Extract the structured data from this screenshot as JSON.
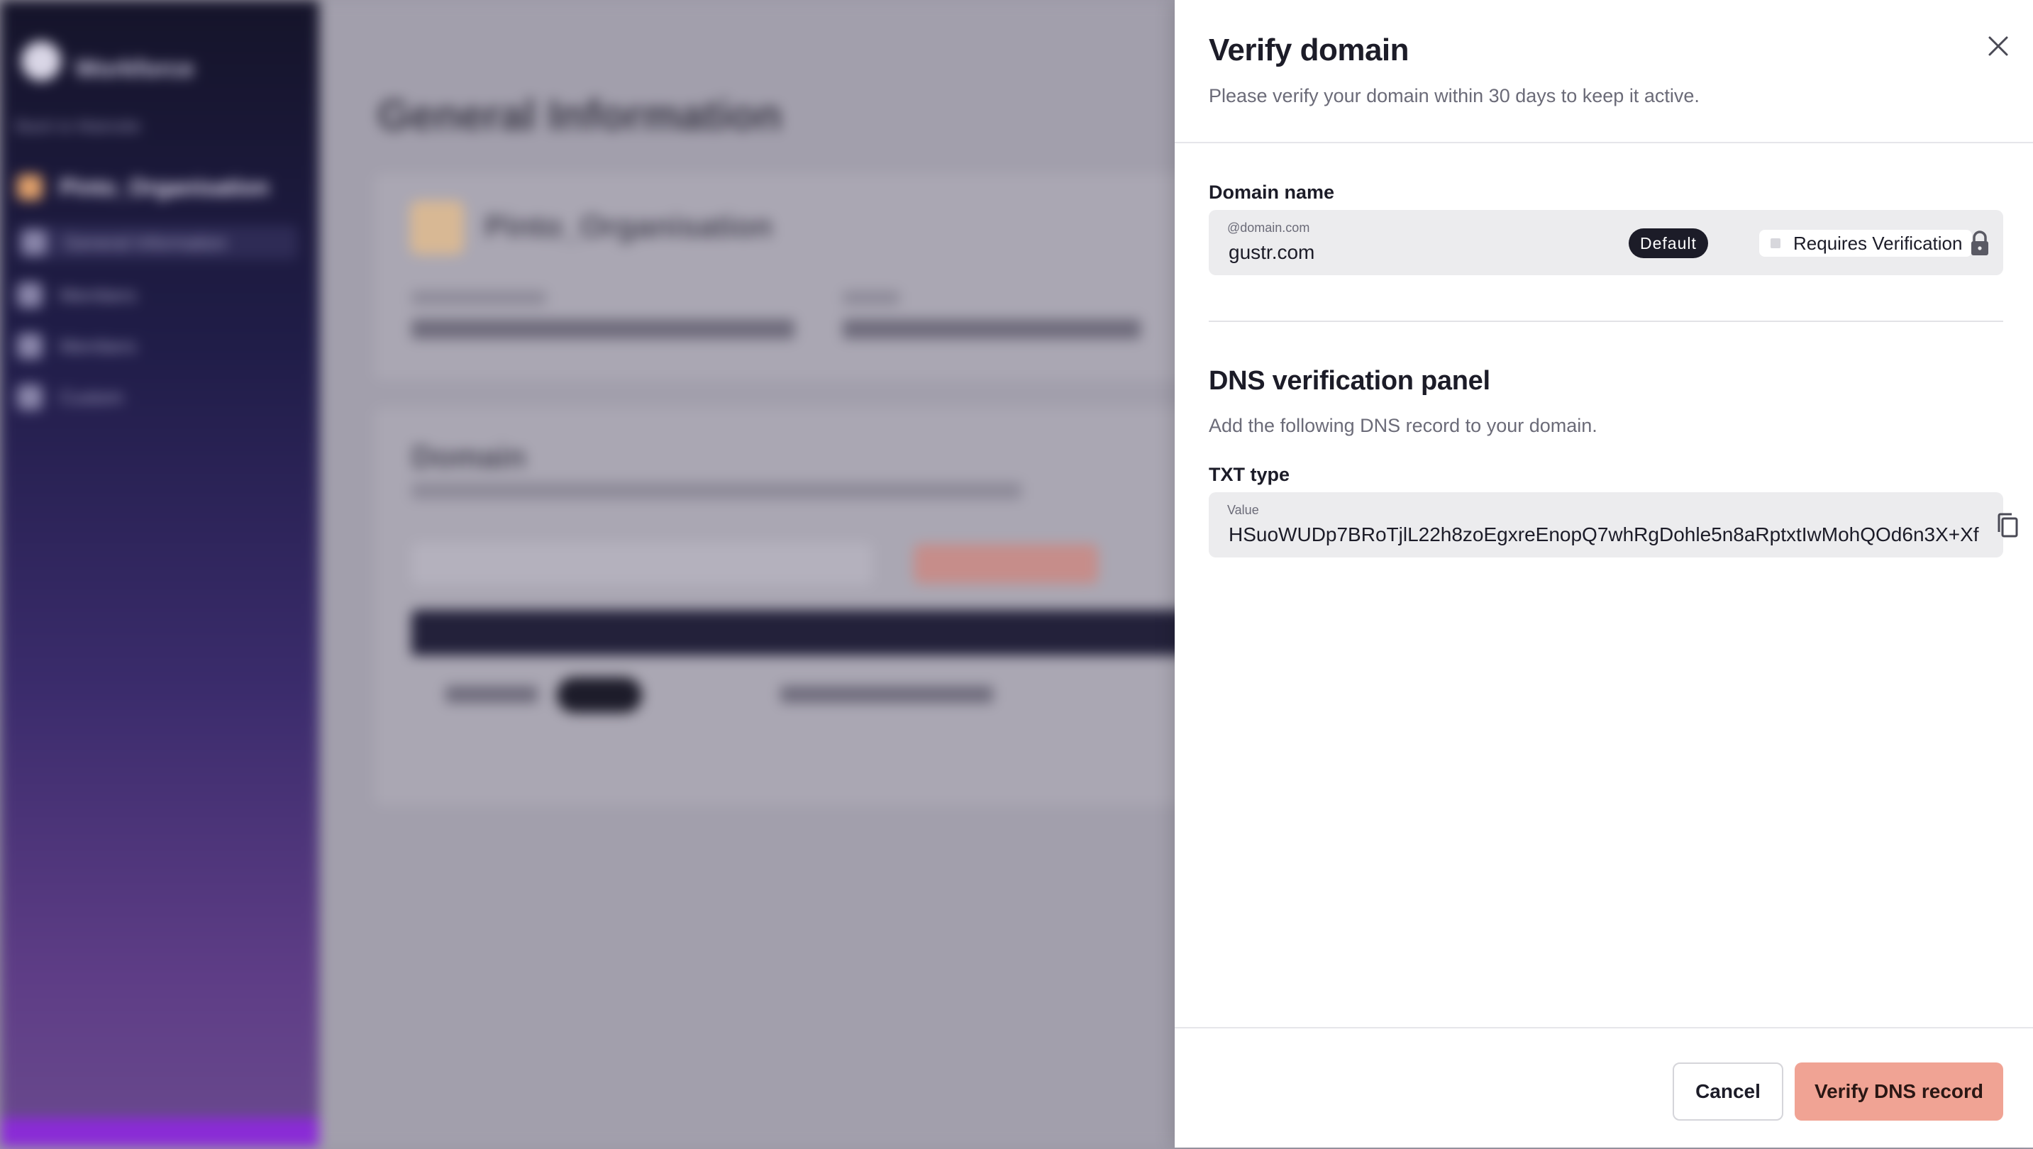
{
  "background": {
    "sidebar": {
      "logo_text": "Workforce",
      "back_link": "Back to Mainsite",
      "org_name": "Pinto_Organisation",
      "items": [
        "General Information",
        "Members",
        "Members",
        "Custom"
      ]
    },
    "page_title": "General Information",
    "org_card_name": "Pinto_Organisation",
    "domain_card_title": "Domain"
  },
  "drawer": {
    "title": "Verify domain",
    "subtitle": "Please verify your domain within 30 days to keep it active.",
    "domain_section": {
      "label": "Domain name",
      "placeholder": "@domain.com",
      "value": "gustr.com",
      "default_badge": "Default",
      "status_badge": "Requires Verification"
    },
    "dns_panel": {
      "title": "DNS verification panel",
      "subtitle": "Add the following DNS record to your domain.",
      "record_label": "TXT type",
      "value_label": "Value",
      "value": "HSuoWUDp7BRoTjlL22h8zoEgxreEnopQ7whRgDohle5n8aRptxtIwMohQOd6n3X+Xf"
    },
    "footer": {
      "cancel_label": "Cancel",
      "verify_label": "Verify DNS record"
    }
  },
  "colors": {
    "overlay": "#9c99a6",
    "primary_button": "#f0a394",
    "badge_dark": "#1c1c28",
    "field_bg": "#ececee"
  },
  "icons": [
    "close-icon",
    "lock-icon",
    "copy-icon"
  ]
}
